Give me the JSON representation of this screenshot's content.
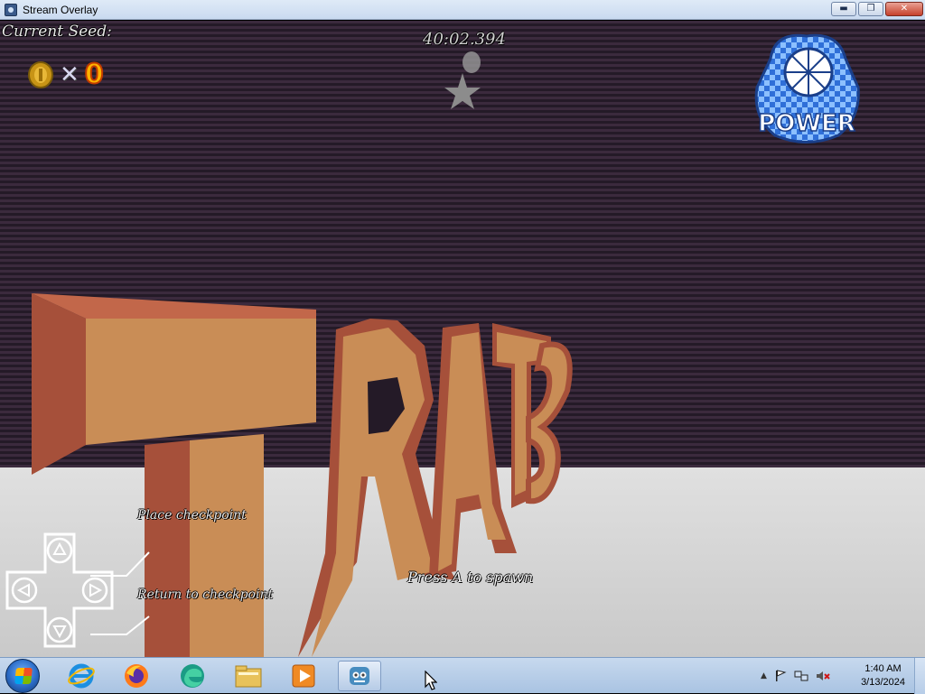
{
  "window": {
    "title": "Stream Overlay",
    "buttons": {
      "minimize": "▬",
      "maximize": "❐",
      "close": "✕"
    }
  },
  "hud": {
    "seed_label": "Current Seed:",
    "coin_multiplier": "✕",
    "coin_count": "0",
    "timer": "40:02.394",
    "power_logo_text": "POWER"
  },
  "scene": {
    "sign_text": "START",
    "press_to_spawn": "Press A to spawn"
  },
  "controls": {
    "place_checkpoint": "Place checkpoint",
    "return_to_checkpoint": "Return to checkpoint",
    "dpad_buttons": [
      "up",
      "left",
      "right",
      "down"
    ]
  },
  "taskbar": {
    "apps": [
      "start-orb",
      "internet-explorer-icon",
      "firefox-icon",
      "edge-icon",
      "file-explorer-icon",
      "media-player-icon",
      "godot-icon"
    ],
    "clock_time": "1:40 AM",
    "clock_date": "3/13/2024"
  },
  "colors": {
    "sky_stripe_dark": "#241a27",
    "sky_stripe_light": "#3b2a3d",
    "floor": "#d4d4d4",
    "letter_face": "#c98d56",
    "letter_side": "#a6503a",
    "coin_count": "#ffb300"
  }
}
